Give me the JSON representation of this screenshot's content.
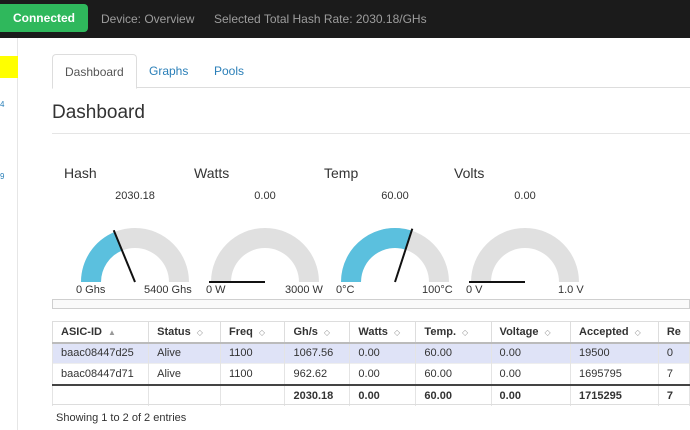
{
  "header": {
    "status": "Connected",
    "device": "Device: Overview",
    "hashrate": "Selected Total Hash Rate: 2030.18/GHs"
  },
  "sidebar": {
    "nums": [
      "4",
      "9"
    ]
  },
  "tabs": [
    "Dashboard",
    "Graphs",
    "Pools"
  ],
  "page": {
    "title": "Dashboard"
  },
  "gauges": [
    {
      "label": "Hash",
      "value_text": "2030.18",
      "value": 2030.18,
      "min": 0,
      "max": 5400,
      "min_label": "0 Ghs",
      "max_label": "5400 Ghs"
    },
    {
      "label": "Watts",
      "value_text": "0.00",
      "value": 0,
      "min": 0,
      "max": 3000,
      "min_label": "0 W",
      "max_label": "3000 W"
    },
    {
      "label": "Temp",
      "value_text": "60.00",
      "value": 60,
      "min": 0,
      "max": 100,
      "min_label": "0°C",
      "max_label": "100°C"
    },
    {
      "label": "Volts",
      "value_text": "0.00",
      "value": 0,
      "min": 0,
      "max": 1,
      "min_label": "0 V",
      "max_label": "1.0 V"
    }
  ],
  "colors": {
    "gauge_fill": "#5bc0de",
    "gauge_track": "#e0e0e0",
    "connected": "#2fb85c"
  },
  "table": {
    "headers": [
      "ASIC-ID",
      "Status",
      "Freq",
      "Gh/s",
      "Watts",
      "Temp.",
      "Voltage",
      "Accepted",
      "Re"
    ],
    "rows": [
      [
        "baac08447d25",
        "Alive",
        "1100",
        "1067.56",
        "0.00",
        "60.00",
        "0.00",
        "19500",
        "0"
      ],
      [
        "baac08447d71",
        "Alive",
        "1100",
        "962.62",
        "0.00",
        "60.00",
        "0.00",
        "1695795",
        "7"
      ]
    ],
    "totals": [
      "",
      "",
      "",
      "2030.18",
      "0.00",
      "60.00",
      "0.00",
      "1715295",
      "7"
    ],
    "info": "Showing 1 to 2 of 2 entries"
  }
}
